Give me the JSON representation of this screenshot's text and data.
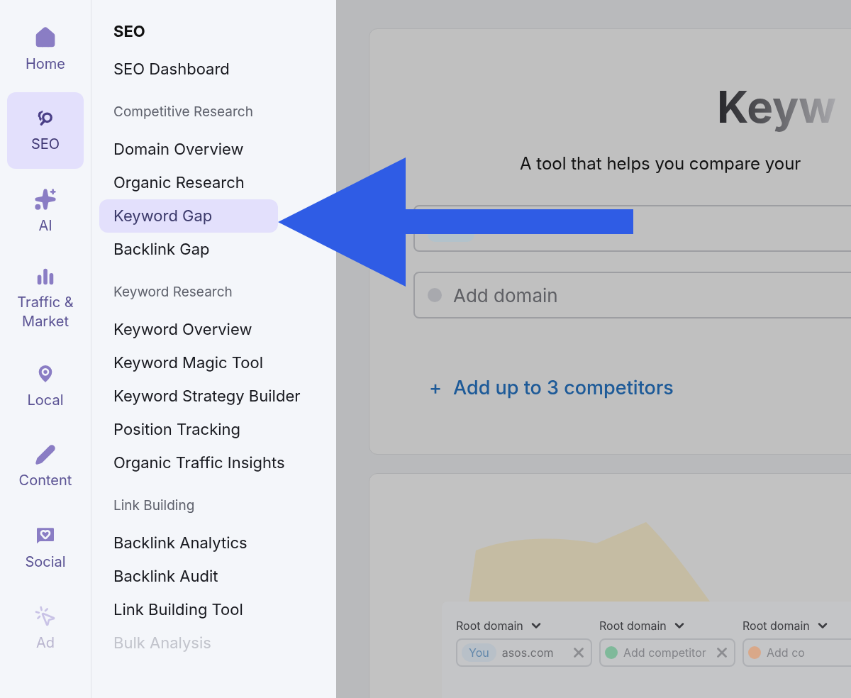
{
  "rail": [
    {
      "label": "Home",
      "selected": false,
      "faded": false
    },
    {
      "label": "SEO",
      "selected": true,
      "faded": false
    },
    {
      "label": "AI",
      "selected": false,
      "faded": false
    },
    {
      "label": "Traffic & Market",
      "selected": false,
      "faded": false
    },
    {
      "label": "Local",
      "selected": false,
      "faded": false
    },
    {
      "label": "Content",
      "selected": false,
      "faded": false
    },
    {
      "label": "Social",
      "selected": false,
      "faded": false
    },
    {
      "label": "Ad",
      "selected": false,
      "faded": true
    }
  ],
  "menu": {
    "title": "SEO",
    "top_items": [
      {
        "label": "SEO Dashboard",
        "selected": false,
        "faded": false
      }
    ],
    "sections": [
      {
        "heading": "Competitive Research",
        "items": [
          {
            "label": "Domain Overview",
            "selected": false,
            "faded": false
          },
          {
            "label": "Organic Research",
            "selected": false,
            "faded": false
          },
          {
            "label": "Keyword Gap",
            "selected": true,
            "faded": false
          },
          {
            "label": "Backlink Gap",
            "selected": false,
            "faded": false
          }
        ]
      },
      {
        "heading": "Keyword Research",
        "items": [
          {
            "label": "Keyword Overview",
            "selected": false,
            "faded": false
          },
          {
            "label": "Keyword Magic Tool",
            "selected": false,
            "faded": false
          },
          {
            "label": "Keyword Strategy Builder",
            "selected": false,
            "faded": false
          },
          {
            "label": "Position Tracking",
            "selected": false,
            "faded": false
          },
          {
            "label": "Organic Traffic Insights",
            "selected": false,
            "faded": false
          }
        ]
      },
      {
        "heading": "Link Building",
        "items": [
          {
            "label": "Backlink Analytics",
            "selected": false,
            "faded": false
          },
          {
            "label": "Backlink Audit",
            "selected": false,
            "faded": false
          },
          {
            "label": "Link Building Tool",
            "selected": false,
            "faded": false
          },
          {
            "label": "Bulk Analysis",
            "selected": false,
            "faded": true
          }
        ]
      }
    ]
  },
  "main": {
    "title": "Keyw",
    "subtitle": "A tool that helps you compare your",
    "domain_fields": [
      {
        "kind": "chip"
      },
      {
        "kind": "dot",
        "placeholder": "Add domain"
      }
    ],
    "add_link": {
      "icon": "+",
      "label": "Add up to 3 competitors"
    },
    "preview": {
      "columns": [
        {
          "label": "Root domain",
          "badge": "You",
          "value": "asos.com"
        },
        {
          "label": "Root domain",
          "placeholder": "Add competitor",
          "color": "#7fb99a"
        },
        {
          "label": "Root domain",
          "placeholder": "Add co",
          "color": "#d9a889"
        }
      ]
    }
  }
}
